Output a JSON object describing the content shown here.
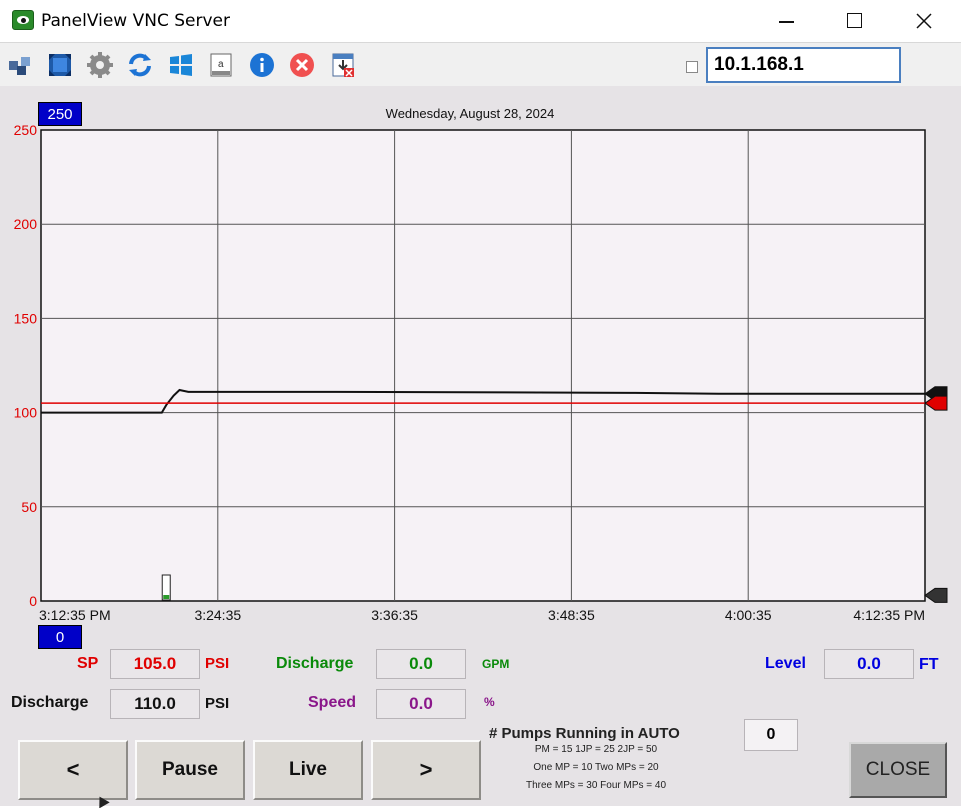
{
  "window": {
    "title": "PanelView VNC Server",
    "minimize": "minimize",
    "maximize": "maximize",
    "close": "close"
  },
  "toolbar": {
    "icons": [
      "network-icon",
      "fullscreen-icon",
      "settings-gear-icon",
      "refresh-icon",
      "windows-icon",
      "clipboard-icon",
      "info-icon",
      "disconnect-icon",
      "save-close-icon"
    ],
    "ip_address": "10.1.168.1"
  },
  "chart": {
    "date": "Wednesday, August 28, 2024",
    "ymax_box": "250",
    "ymin_box": "0"
  },
  "chart_data": {
    "type": "line",
    "title": "Wednesday, August 28, 2024",
    "xlabel": "",
    "ylabel": "",
    "ylim": [
      0,
      250
    ],
    "yticks": [
      "250",
      "200",
      "150",
      "100",
      "50",
      "0"
    ],
    "x_tick_labels": [
      "3:12:35 PM",
      "3:24:35",
      "3:36:35",
      "3:48:35",
      "4:00:35",
      "4:12:35 PM"
    ],
    "x_minutes_range": [
      0,
      60
    ],
    "grid": true,
    "series": [
      {
        "color": "#111111",
        "x": [
          0,
          8.2,
          8.5,
          9.0,
          9.4,
          10.0,
          20,
          40,
          46,
          47,
          60
        ],
        "y": [
          100,
          100,
          104,
          109,
          112,
          111,
          111,
          110.5,
          110,
          110,
          110
        ]
      },
      {
        "color": "#e00000",
        "x": [
          0,
          60
        ],
        "y": [
          105,
          105
        ]
      }
    ]
  },
  "readings": {
    "sp_label": "SP",
    "sp_value": "105.0",
    "sp_unit": "PSI",
    "discharge_label": "Discharge",
    "discharge_value": "110.0",
    "discharge_unit": "PSI",
    "flow_label": "Discharge",
    "flow_value": "0.0",
    "flow_unit": "GPM",
    "speed_label": "Speed",
    "speed_value": "0.0",
    "speed_unit": "%",
    "level_label": "Level",
    "level_value": "0.0",
    "level_unit": "FT"
  },
  "pumps": {
    "title": "# Pumps Running in AUTO",
    "value": "0",
    "line1": "PM =  15   1JP =  25  2JP = 50",
    "line2": "One MP = 10  Two MPs = 20",
    "line3": "Three MPs = 30  Four MPs = 40"
  },
  "buttons": {
    "prev": "<",
    "pause": "Pause",
    "live": "Live",
    "next": ">",
    "close": "CLOSE"
  },
  "colors": {
    "red": "#e00000",
    "green": "#0a8a0a",
    "blue": "#0000e0",
    "purple": "#8a168a",
    "navy": "#0000c8"
  }
}
